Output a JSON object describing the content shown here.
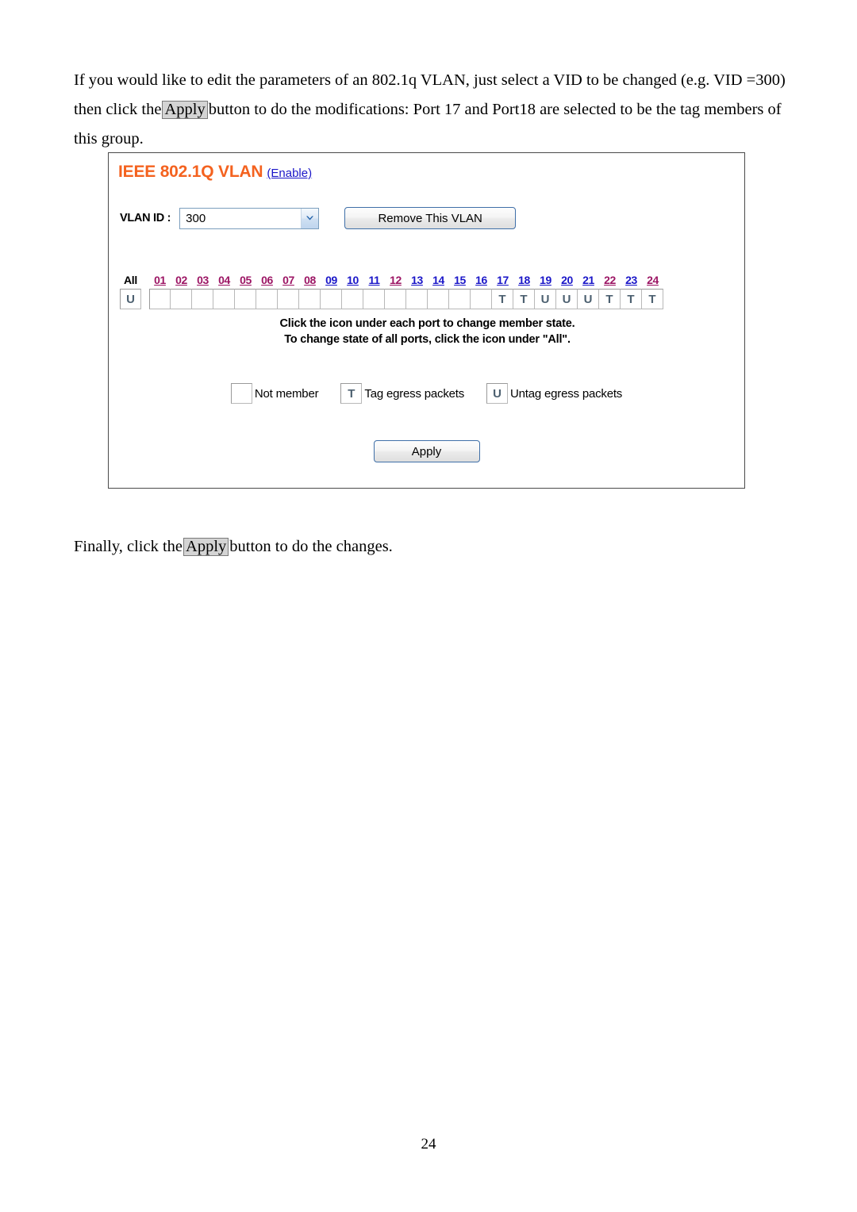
{
  "document": {
    "intro_paragraph": {
      "before": "If you would like to edit the parameters of an 802.1q VLAN, just select a VID to be changed (e.g. VID =300) then click the",
      "inline_button": "Apply",
      "after": "button to do the modifications: Port 17 and Port18 are selected to be the tag members of this group."
    },
    "final_paragraph": {
      "before": "Finally, click the",
      "inline_button": "Apply",
      "after": "button to do the changes."
    },
    "page_number": "24"
  },
  "panel": {
    "title": "IEEE 802.1Q VLAN",
    "enable_link": "(Enable)",
    "title_color": "#f4621f",
    "link_color": "#1a16c8",
    "vlan_id": {
      "label": "VLAN ID :",
      "selected_value": "300",
      "options": [
        "300"
      ]
    },
    "remove_button": "Remove This VLAN",
    "apply_button": "Apply",
    "ports": {
      "all_label": "All",
      "all_state": "U",
      "columns": [
        {
          "num": "01",
          "state": "",
          "color": "purple"
        },
        {
          "num": "02",
          "state": "",
          "color": "purple"
        },
        {
          "num": "03",
          "state": "",
          "color": "purple"
        },
        {
          "num": "04",
          "state": "",
          "color": "purple"
        },
        {
          "num": "05",
          "state": "",
          "color": "purple"
        },
        {
          "num": "06",
          "state": "",
          "color": "purple"
        },
        {
          "num": "07",
          "state": "",
          "color": "purple"
        },
        {
          "num": "08",
          "state": "",
          "color": "purple"
        },
        {
          "num": "09",
          "state": "",
          "color": "blue"
        },
        {
          "num": "10",
          "state": "",
          "color": "blue"
        },
        {
          "num": "11",
          "state": "",
          "color": "blue"
        },
        {
          "num": "12",
          "state": "",
          "color": "purple"
        },
        {
          "num": "13",
          "state": "",
          "color": "blue"
        },
        {
          "num": "14",
          "state": "",
          "color": "blue"
        },
        {
          "num": "15",
          "state": "",
          "color": "blue"
        },
        {
          "num": "16",
          "state": "",
          "color": "blue"
        },
        {
          "num": "17",
          "state": "T",
          "color": "blue"
        },
        {
          "num": "18",
          "state": "T",
          "color": "blue"
        },
        {
          "num": "19",
          "state": "U",
          "color": "blue"
        },
        {
          "num": "20",
          "state": "U",
          "color": "blue"
        },
        {
          "num": "21",
          "state": "U",
          "color": "blue"
        },
        {
          "num": "22",
          "state": "T",
          "color": "purple"
        },
        {
          "num": "23",
          "state": "T",
          "color": "blue"
        },
        {
          "num": "24",
          "state": "T",
          "color": "purple"
        }
      ]
    },
    "hint_line_1": "Click the icon under each port to change member state.",
    "hint_line_2": "To change state of all ports, click the icon under \"All\".",
    "legend": [
      {
        "symbol": "",
        "text": "Not member"
      },
      {
        "symbol": "T",
        "text": "Tag egress packets"
      },
      {
        "symbol": "U",
        "text": "Untag egress packets"
      }
    ]
  }
}
